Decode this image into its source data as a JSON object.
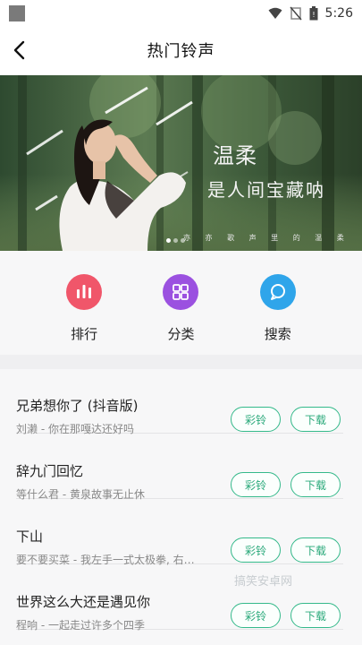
{
  "status_bar": {
    "time": "5:26"
  },
  "header": {
    "title": "热门铃声"
  },
  "banner": {
    "line1": "温柔",
    "line2": "是人间宝藏呐",
    "small_text": "亦 亦 歌 声 里 的 温 柔",
    "dot_count": 3,
    "active_dot": 0
  },
  "categories": [
    {
      "label": "排行",
      "icon": "ranking-bars-icon",
      "color": "#f0566a"
    },
    {
      "label": "分类",
      "icon": "grid-category-icon",
      "color": "#9b51e0"
    },
    {
      "label": "搜索",
      "icon": "search-bubble-icon",
      "color": "#2fa5ea"
    }
  ],
  "songs": [
    {
      "title": "兄弟想你了 (抖音版)",
      "subtitle": "刘濑 - 你在那嘎达还好吗",
      "ring_label": "彩铃",
      "download_label": "下载"
    },
    {
      "title": "辞九门回忆",
      "subtitle": "等什么君 - 黄泉故事无止休",
      "ring_label": "彩铃",
      "download_label": "下载"
    },
    {
      "title": "下山",
      "subtitle": "要不要买菜 - 我左手一式太极拳, 右…",
      "ring_label": "彩铃",
      "download_label": "下载"
    },
    {
      "title": "世界这么大还是遇见你",
      "subtitle": "程响 - 一起走过许多个四季",
      "ring_label": "彩铃",
      "download_label": "下载"
    }
  ],
  "watermark": "搞笑安卓网",
  "colors": {
    "accent_green": "#34b98a"
  }
}
